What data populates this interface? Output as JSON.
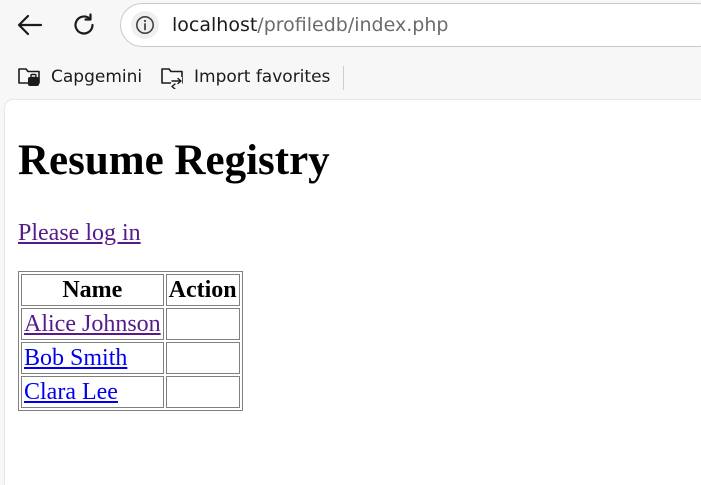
{
  "browser": {
    "url_host": "localhost",
    "url_path": "/profiledb/index.php",
    "icons": {
      "back": "arrow-left-icon",
      "reload": "reload-icon",
      "site_info": "info-icon",
      "favorite_folder": "folder-icon"
    },
    "favorites": [
      {
        "label": "Capgemini"
      },
      {
        "label": "Import favorites"
      }
    ]
  },
  "page": {
    "title": "Resume Registry",
    "login_link": "Please log in",
    "table": {
      "headers": [
        "Name",
        "Action"
      ],
      "rows": [
        {
          "name": "Alice Johnson",
          "action": ""
        },
        {
          "name": "Bob Smith",
          "action": ""
        },
        {
          "name": "Clara Lee",
          "action": ""
        }
      ]
    },
    "colors": {
      "visited_link": "#551a8b",
      "link": "#0000ee"
    }
  }
}
